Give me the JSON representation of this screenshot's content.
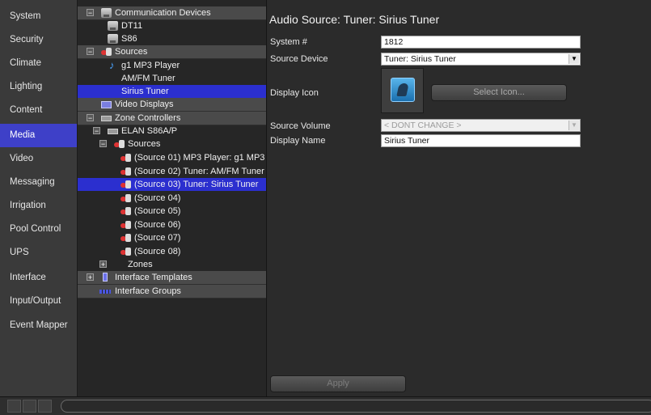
{
  "sidebar": {
    "active": "Media",
    "items": [
      {
        "label": "System"
      },
      {
        "label": "Security"
      },
      {
        "label": "Climate"
      },
      {
        "label": "Lighting"
      },
      {
        "label": "Content"
      },
      {
        "label": "Media"
      },
      {
        "label": "Video"
      },
      {
        "label": "Messaging"
      },
      {
        "label": "Irrigation"
      },
      {
        "label": "Pool Control"
      },
      {
        "label": "UPS"
      },
      {
        "label": "Interface"
      },
      {
        "label": "Input/Output"
      },
      {
        "label": "Event Mapper"
      }
    ]
  },
  "tree": {
    "communication_devices": "Communication Devices",
    "dt11": "DT11",
    "s86": "S86",
    "sources": "Sources",
    "g1_mp3_player": "g1 MP3 Player",
    "am_fm_tuner": "AM/FM Tuner",
    "sirius_tuner": "Sirius Tuner",
    "video_displays": "Video Displays",
    "zone_controllers": "Zone Controllers",
    "elan_s86ap": "ELAN S86A/P",
    "zc_sources": "Sources",
    "zone_sources": [
      "(Source 01) MP3 Player: g1 MP3",
      "(Source 02) Tuner: AM/FM Tuner",
      "(Source 03) Tuner: Sirius Tuner",
      "(Source 04)",
      "(Source 05)",
      "(Source 06)",
      "(Source 07)",
      "(Source 08)"
    ],
    "zones": "Zones",
    "interface_templates": "Interface Templates",
    "interface_groups": "Interface Groups",
    "expand_minus": "−",
    "expand_plus": "+"
  },
  "detail": {
    "title": "Audio Source: Tuner: Sirius Tuner",
    "system_label": "System #",
    "system_value": "1812",
    "source_device_label": "Source Device",
    "source_device_value": "Tuner: Sirius Tuner",
    "display_icon_label": "Display Icon",
    "select_icon_button": "Select Icon...",
    "source_volume_label": "Source Volume",
    "source_volume_value": "< DONT CHANGE >",
    "display_name_label": "Display Name",
    "display_name_value": "Sirius Tuner",
    "apply_button": "Apply",
    "dropdown_arrow": "▼"
  },
  "colors": {
    "selection": "#2b2fcf",
    "sidebar_active": "#3e40c8",
    "music_note": "#4aa3ff"
  }
}
